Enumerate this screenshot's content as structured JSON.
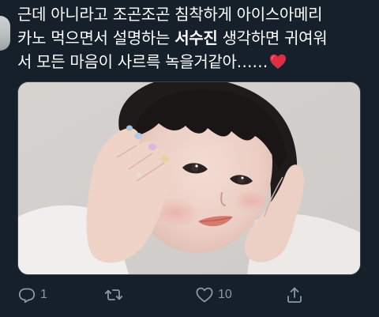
{
  "tweet": {
    "line1": "근데 아니라고 조곤조곤 침착하게 아이스아메리",
    "line2_before": "카노 먹으면서 설명하는 ",
    "line2_bold": "서수진",
    "line2_after": " 생각하면 귀여워",
    "line3": "서 모든 마음이 사르륵 녹을거같아……",
    "emoji": "heart-emoji"
  },
  "actions": {
    "reply_count": "1",
    "retweet_count": "",
    "like_count": "10",
    "share_count": ""
  },
  "colors": {
    "background": "#15202b",
    "text": "#ffffff",
    "muted": "#8899a6",
    "heart": "#e0245e"
  }
}
